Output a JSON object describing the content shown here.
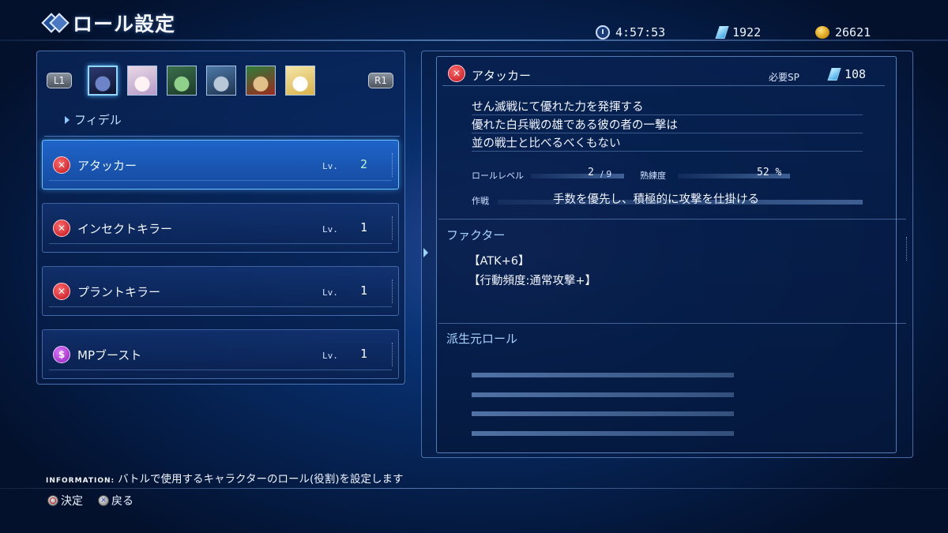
{
  "header": {
    "title": "ロール設定",
    "time": "4:57:53",
    "crystals": "1922",
    "coins": "26621"
  },
  "left": {
    "l_button": "L1",
    "r_button": "R1",
    "party": [
      {
        "name": "avatar-1",
        "selected": true,
        "colors": [
          "#2c3a70",
          "#0e1530",
          "#6b85c8"
        ]
      },
      {
        "name": "avatar-2",
        "selected": false,
        "colors": [
          "#e8d9e6",
          "#b69ac8",
          "#fff2f4"
        ]
      },
      {
        "name": "avatar-3",
        "selected": false,
        "colors": [
          "#3a6f4a",
          "#1d3a2a",
          "#8fd08a"
        ]
      },
      {
        "name": "avatar-4",
        "selected": false,
        "colors": [
          "#4d7aa8",
          "#1f3350",
          "#b8c8d8"
        ]
      },
      {
        "name": "avatar-5",
        "selected": false,
        "colors": [
          "#2e7d3a",
          "#9c2b1f",
          "#e2c08a"
        ]
      },
      {
        "name": "avatar-6",
        "selected": false,
        "colors": [
          "#f4e6a8",
          "#d9b24a",
          "#ffffff"
        ]
      }
    ],
    "character_name": "フィデル",
    "roles": [
      {
        "name": "アタッカー",
        "lv_label": "Lv.",
        "level": "2",
        "icon": "sword-icon",
        "active": true
      },
      {
        "name": "インセクトキラー",
        "lv_label": "Lv.",
        "level": "1",
        "icon": "sword-icon",
        "active": false
      },
      {
        "name": "プラントキラー",
        "lv_label": "Lv.",
        "level": "1",
        "icon": "sword-icon",
        "active": false
      },
      {
        "name": "MPブースト",
        "lv_label": "Lv.",
        "level": "1",
        "icon": "mp-icon",
        "active": false
      }
    ]
  },
  "detail": {
    "title": "アタッカー",
    "sp_label": "必要SP",
    "sp_value": "108",
    "description": [
      "せん滅戦にて優れた力を発揮する",
      "優れた白兵戦の雄である彼の者の一撃は",
      "並の戦士と比べるべくもない"
    ],
    "role_level_label": "ロールレベル",
    "role_level_value": "2",
    "role_level_max": "/ 9",
    "mastery_label": "熟練度",
    "mastery_value": "52 %",
    "tactic_label": "作戦",
    "tactic_text": "手数を優先し、積極的に攻撃を仕掛ける",
    "factor_title": "ファクター",
    "factors": [
      "【ATK+6】",
      "【行動頻度:通常攻撃+】"
    ],
    "derive_title": "派生元ロール"
  },
  "footer": {
    "info_tag": "INFORMATION:",
    "info_text": "バトルで使用するキャラクターのロール(役割)を設定します",
    "confirm": "決定",
    "back": "戻る"
  }
}
